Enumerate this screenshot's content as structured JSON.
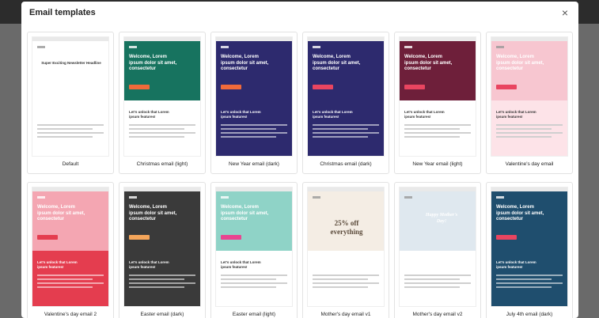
{
  "modal": {
    "title": "Email templates",
    "close_icon": "×"
  },
  "templates": [
    {
      "label": "Default",
      "hero_text": "Super Exciting Newsletter Headline",
      "theme": "#ffffff",
      "accent": "#f6a01a"
    },
    {
      "label": "Christmas email (light)",
      "hero_text": "Welcome, Lorem ipsum dolor sit amet, consectetur",
      "sub_text": "Let's unlock that Lorem ipsum features!",
      "theme": "#17735f",
      "accent": "#f06a3a"
    },
    {
      "label": "New Year email (dark)",
      "hero_text": "Welcome, Lorem ipsum dolor sit amet, consectetur",
      "sub_text": "Let's unlock that Lorem ipsum features!",
      "theme": "#2d2a6e",
      "accent": "#f06a3a"
    },
    {
      "label": "Christmas email (dark)",
      "hero_text": "Welcome, Lorem ipsum dolor sit amet, consectetur",
      "sub_text": "Let's unlock that Lorem ipsum features!",
      "theme": "#2d2a6e",
      "accent": "#e94560"
    },
    {
      "label": "New Year email (light)",
      "hero_text": "Welcome, Lorem ipsum dolor sit amet, consectetur",
      "sub_text": "Let's unlock that Lorem ipsum features!",
      "theme": "#6e1f3a",
      "accent": "#e94560"
    },
    {
      "label": "Valentine's day email",
      "hero_text": "Welcome, Lorem ipsum dolor sit amet, consectetur",
      "sub_text": "Let's unlock that Lorem ipsum features!",
      "theme": "#f7c6d0",
      "accent": "#e94560"
    },
    {
      "label": "Valentine's day email 2",
      "hero_text": "Welcome, Lorem ipsum dolor sit amet, consectetur",
      "sub_text": "Let's unlock that Lorem ipsum features!",
      "theme": "#f4a6b2",
      "accent": "#e43d4f"
    },
    {
      "label": "Easter email (dark)",
      "hero_text": "Welcome, Lorem ipsum dolor sit amet, consectetur",
      "sub_text": "Let's unlock that Lorem ipsum features!",
      "theme": "#3a3a3a",
      "accent": "#f4a55a"
    },
    {
      "label": "Easter email (light)",
      "hero_text": "Welcome, Lorem ipsum dolor sit amet, consectetur",
      "sub_text": "Let's unlock that Lorem ipsum features!",
      "theme": "#8fd3c7",
      "accent": "#e94590"
    },
    {
      "label": "Mother's day email v1",
      "hero_text": "25% off everything",
      "theme": "#f4ede4",
      "accent": "#6cc3a0"
    },
    {
      "label": "Mother's day email v2",
      "hero_text": "Happy Mother's Day!",
      "theme": "#dfe8ef",
      "accent": "#7a9ab5"
    },
    {
      "label": "July 4th email (dark)",
      "hero_text": "Welcome, Lorem ipsum dolor sit amet, consectetur",
      "sub_text": "Let's unlock that Lorem ipsum features!",
      "theme": "#1f4e6e",
      "accent": "#e94560"
    }
  ]
}
